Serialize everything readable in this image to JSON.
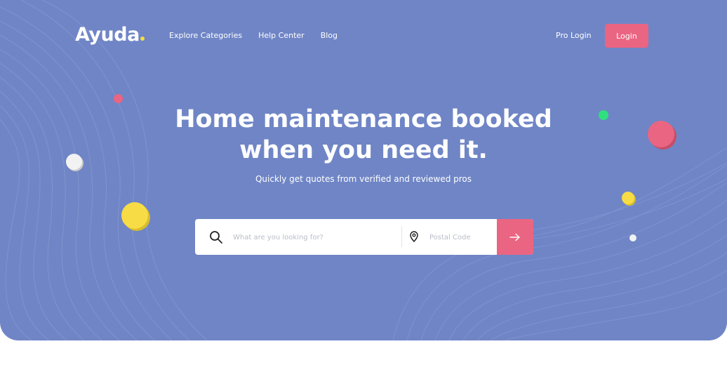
{
  "header": {
    "logo_text": "Ayuda",
    "nav": [
      "Explore Categories",
      "Help Center",
      "Blog"
    ],
    "pro_login": "Pro Login",
    "login": "Login"
  },
  "hero": {
    "headline_line1": "Home maintenance booked",
    "headline_line2": "when you need it.",
    "subtitle": "Quickly get quotes from verified and reviewed pros"
  },
  "search": {
    "query_placeholder": "What are you looking for?",
    "postal_placeholder": "Postal Code"
  },
  "colors": {
    "hero_bg": "#6f85c6",
    "accent_pink": "#ea6582",
    "yellow": "#f7dc45",
    "green": "#2fe07e"
  },
  "icons": [
    "search-icon",
    "location-pin-icon",
    "arrow-right-icon"
  ]
}
